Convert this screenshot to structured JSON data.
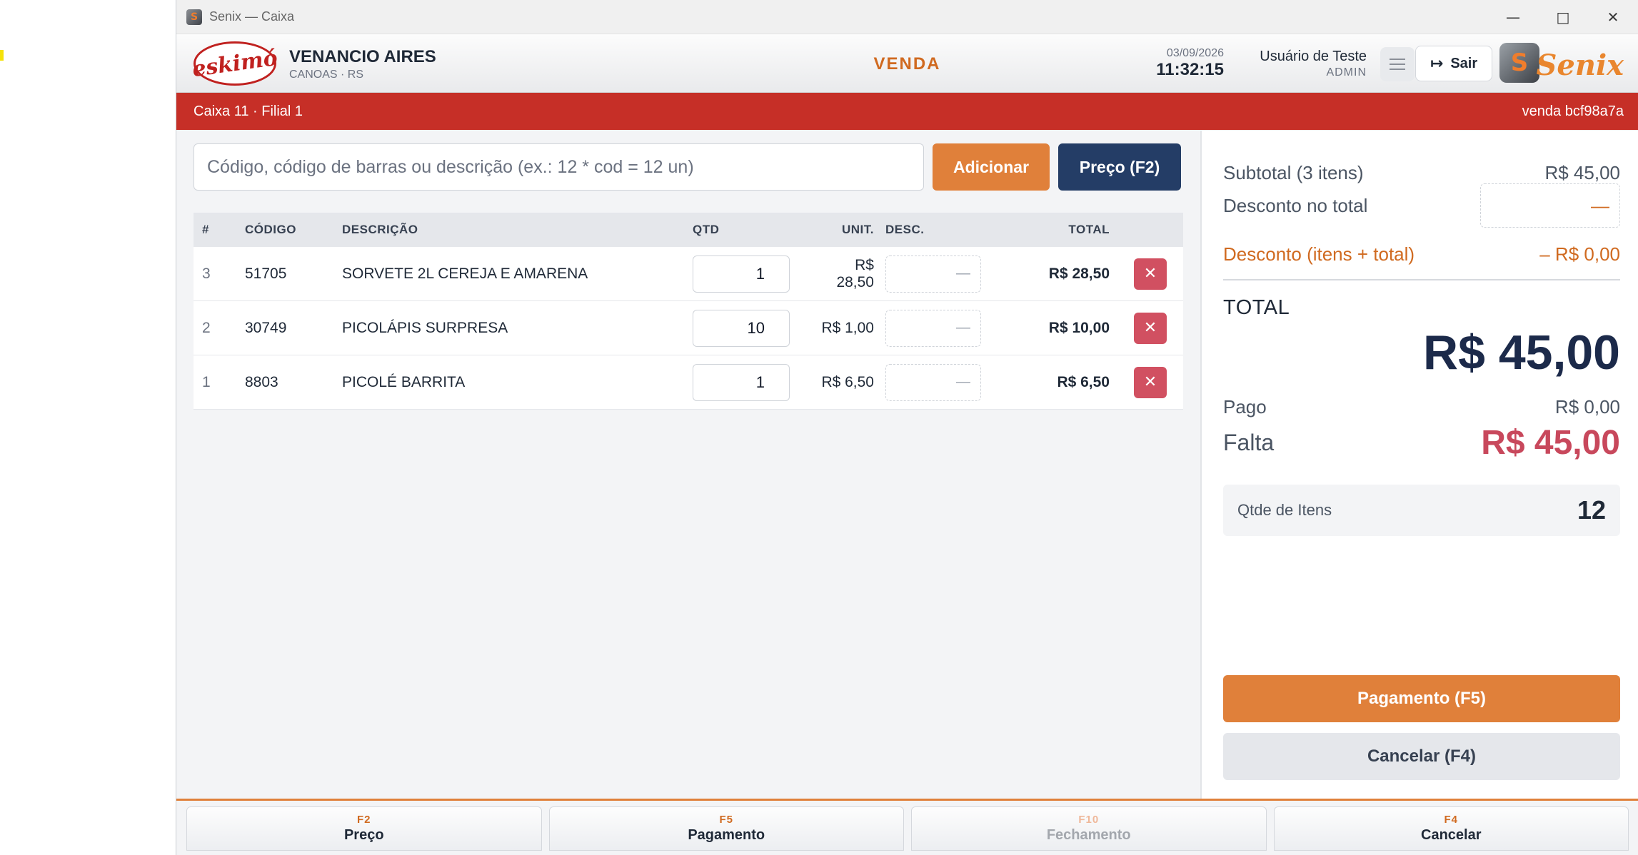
{
  "window": {
    "title": "Senix — Caixa"
  },
  "header": {
    "logo_text": "eskimó",
    "store_name": "VENANCIO AIRES",
    "store_city": "CANOAS · RS",
    "mode": "VENDA",
    "date": "03/09/2026",
    "time": "11:32:15",
    "user_name": "Usuário de Teste",
    "user_role": "ADMIN",
    "exit_label": "Sair",
    "brand_text": "Senix"
  },
  "infobar": {
    "left": "Caixa 11 · Filial 1",
    "right": "venda bcf98a7a"
  },
  "search": {
    "placeholder": "Código, código de barras ou descrição (ex.: 12 * cod = 12 un)",
    "value": "",
    "add_label": "Adicionar",
    "price_label": "Preço (F2)"
  },
  "table": {
    "headers": {
      "num": "#",
      "code": "CÓDIGO",
      "desc": "DESCRIÇÃO",
      "qty": "QTD",
      "unit": "UNIT.",
      "discount": "DESC.",
      "total": "TOTAL"
    },
    "rows": [
      {
        "num": "3",
        "code": "51705",
        "desc": "SORVETE 2L CEREJA E AMARENA",
        "qty": "1",
        "unit": "R$ 28,50",
        "discount": "—",
        "total": "R$ 28,50"
      },
      {
        "num": "2",
        "code": "30749",
        "desc": "PICOLÁPIS SURPRESA",
        "qty": "10",
        "unit": "R$ 1,00",
        "discount": "—",
        "total": "R$ 10,00"
      },
      {
        "num": "1",
        "code": "8803",
        "desc": "PICOLÉ BARRITA",
        "qty": "1",
        "unit": "R$ 6,50",
        "discount": "—",
        "total": "R$ 6,50"
      }
    ]
  },
  "summary": {
    "subtotal_label": "Subtotal (3 itens)",
    "subtotal_value": "R$ 45,00",
    "discount_total_label": "Desconto no total",
    "discount_total_value": "—",
    "discount_all_label": "Desconto (itens + total)",
    "discount_all_value": "– R$ 0,00",
    "total_label": "TOTAL",
    "total_value": "R$ 45,00",
    "paid_label": "Pago",
    "paid_value": "R$ 0,00",
    "missing_label": "Falta",
    "missing_value": "R$ 45,00",
    "qty_label": "Qtde de Itens",
    "qty_value": "12",
    "pay_button": "Pagamento (F5)",
    "cancel_button": "Cancelar (F4)"
  },
  "footer": [
    {
      "key": "F2",
      "label": "Preço",
      "enabled": true
    },
    {
      "key": "F5",
      "label": "Pagamento",
      "enabled": true
    },
    {
      "key": "F10",
      "label": "Fechamento",
      "enabled": false
    },
    {
      "key": "F4",
      "label": "Cancelar",
      "enabled": true
    }
  ],
  "colors": {
    "accent": "#e0803a",
    "brand_red": "#c62f27",
    "navy": "#243d66",
    "danger": "#d15061"
  }
}
